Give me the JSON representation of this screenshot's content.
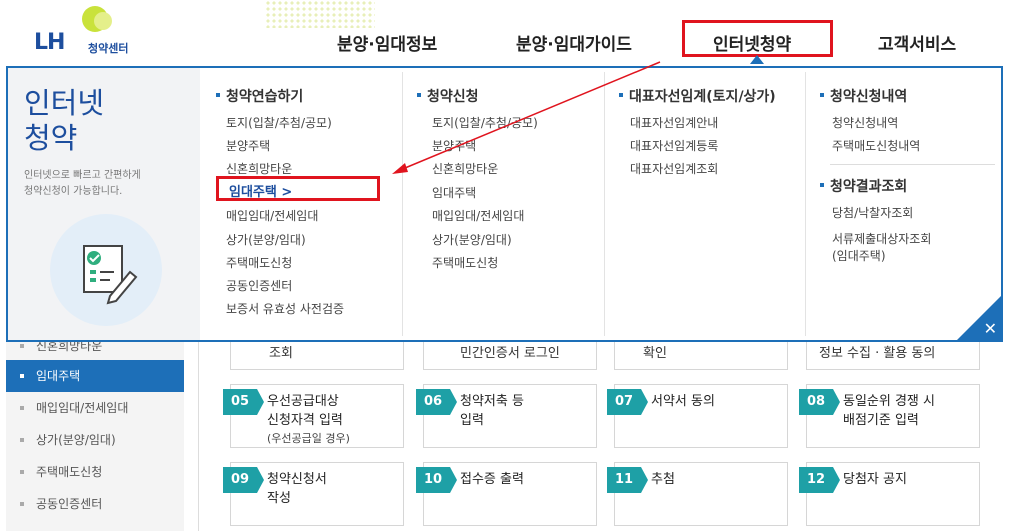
{
  "header": {
    "logo_brand": "LH",
    "logo_sub": "청약센터",
    "nav": [
      "분양·임대정보",
      "분양·임대가이드",
      "인터넷청약",
      "고객서비스"
    ]
  },
  "mega": {
    "intro_title_1": "인터넷",
    "intro_title_2": "청약",
    "intro_desc_1": "인터넷으로 빠르고 간편하게",
    "intro_desc_2": "청약신청이 가능합니다.",
    "col1": {
      "title": "청약연습하기",
      "items": [
        "토지(입찰/추첨/공모)",
        "분양주택",
        "신혼희망타운",
        "임대주택 >",
        "매입임대/전세임대",
        "상가(분양/임대)",
        "주택매도신청",
        "공동인증센터",
        "보증서 유효성 사전검증"
      ]
    },
    "col2": {
      "title": "청약신청",
      "items": [
        "토지(입찰/추첨/공모)",
        "분양주택",
        "신혼희망타운",
        "임대주택",
        "매입임대/전세임대",
        "상가(분양/임대)",
        "주택매도신청"
      ]
    },
    "col3": {
      "title": "대표자선임계(토지/상가)",
      "items": [
        "대표자선임계안내",
        "대표자선임계등록",
        "대표자선임계조회"
      ]
    },
    "col4": {
      "title_a": "청약신청내역",
      "items_a": [
        "청약신청내역",
        "주택매도신청내역"
      ],
      "title_b": "청약결과조회",
      "items_b": [
        "당첨/낙찰자조회",
        "서류제출대상자조회",
        "(임대주택)"
      ]
    },
    "close": "✕"
  },
  "sidebar": {
    "items": [
      "신혼희망타운",
      "임대주택",
      "매입임대/전세임대",
      "상가(분양/임대)",
      "주택매도신청",
      "공동인증센터"
    ]
  },
  "steps_top": [
    "조회",
    "민간인증서 로그인",
    "확인",
    "정보 수집 · 활용 동의"
  ],
  "steps": [
    {
      "num": "05",
      "title_1": "우선공급대상",
      "title_2": "신청자격 입력",
      "note": "(우선공급일 경우)"
    },
    {
      "num": "06",
      "title_1": "청약저축 등",
      "title_2": "입력",
      "note": ""
    },
    {
      "num": "07",
      "title_1": "서약서 동의",
      "title_2": "",
      "note": ""
    },
    {
      "num": "08",
      "title_1": "동일순위 경쟁 시",
      "title_2": "배점기준 입력",
      "note": ""
    },
    {
      "num": "09",
      "title_1": "청약신청서",
      "title_2": "작성",
      "note": ""
    },
    {
      "num": "10",
      "title_1": "접수증 출력",
      "title_2": "",
      "note": ""
    },
    {
      "num": "11",
      "title_1": "추첨",
      "title_2": "",
      "note": ""
    },
    {
      "num": "12",
      "title_1": "당첨자 공지",
      "title_2": "",
      "note": ""
    }
  ],
  "colors": {
    "primary": "#1d6fb8",
    "teal": "#1ea0a6",
    "highlight": "#e0141e"
  }
}
